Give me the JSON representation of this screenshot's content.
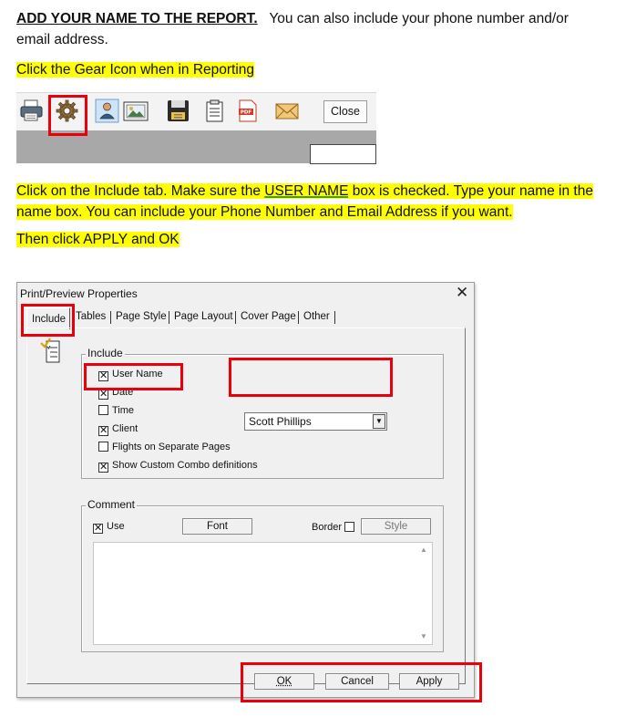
{
  "intro": {
    "heading": "ADD YOUR NAME TO THE REPORT.",
    "text": "You can also include your phone number and/or email address."
  },
  "step1": "Click the Gear Icon when in Reporting",
  "toolbar": {
    "icons": [
      "printer-icon",
      "gear-icon",
      "page-icon",
      "user-icon",
      "picture-icon",
      "save-icon",
      "clipboard-icon",
      "pdf-icon",
      "email-icon"
    ],
    "pdf_label": "PDF",
    "close_label": "Close"
  },
  "step2": {
    "before": "Click on the Include tab.  Make sure the",
    "highlight_word": "USER NAME",
    "after": "box is checked.  Type your name in the name box. You can include your Phone Number and Email Address if you want."
  },
  "step3": "Then click APPLY and OK",
  "dialog": {
    "title": "Print/Preview Properties",
    "close_glyph": "✕",
    "tabs": [
      "Include",
      "Tables",
      "Page Style",
      "Page Layout",
      "Cover Page",
      "Other"
    ],
    "include_group": {
      "label": "Include",
      "options": [
        {
          "label": "User Name",
          "checked": true
        },
        {
          "label": "Date",
          "checked": true
        },
        {
          "label": "Time",
          "checked": false
        },
        {
          "label": "Client",
          "checked": true
        },
        {
          "label": "Flights on Separate Pages",
          "checked": false
        },
        {
          "label": "Show Custom Combo definitions",
          "checked": true
        }
      ],
      "user_combo_value": "Scott Phillips"
    },
    "comment_group": {
      "label": "Comment",
      "use_label": "Use",
      "use_checked": true,
      "font_button": "Font",
      "border_label": "Border",
      "border_checked": false,
      "style_button": "Style"
    },
    "buttons": {
      "ok": "OK",
      "cancel": "Cancel",
      "apply": "Apply"
    }
  },
  "colors": {
    "highlight": "#ffff00",
    "callout_red": "#e8000b"
  }
}
